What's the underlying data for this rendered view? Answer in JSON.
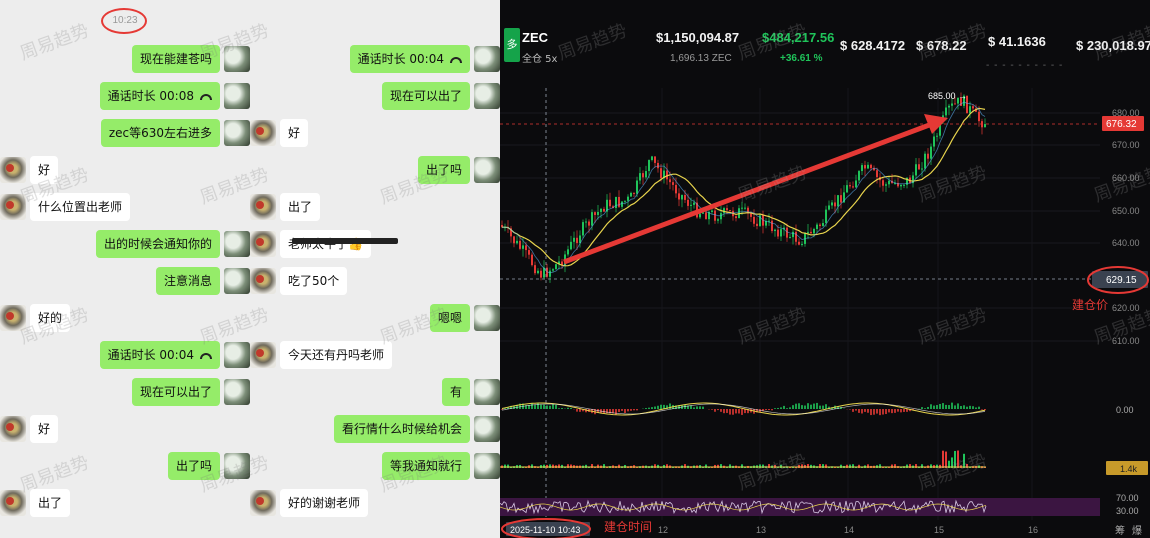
{
  "chat": {
    "timestamp": "10:23",
    "left_column": [
      {
        "side": "me",
        "text": "现在能建苍吗"
      },
      {
        "side": "me",
        "text": "通话时长 00:08",
        "call": true
      },
      {
        "side": "me",
        "text": "zec等630左右进多"
      },
      {
        "side": "them",
        "text": "好"
      },
      {
        "side": "them",
        "text": "什么位置出老师"
      },
      {
        "side": "me",
        "text": "出的时候会通知你的"
      },
      {
        "side": "me",
        "text": "注意消息"
      },
      {
        "side": "them",
        "text": "好的"
      },
      {
        "side": "me",
        "text": "通话时长 00:04",
        "call": true
      },
      {
        "side": "me",
        "text": "现在可以出了"
      },
      {
        "side": "them",
        "text": "好"
      },
      {
        "side": "me",
        "text": "出了吗"
      },
      {
        "side": "them",
        "text": "出了"
      }
    ],
    "right_column": [
      {
        "side": "me",
        "text": "通话时长 00:04",
        "call": true
      },
      {
        "side": "me",
        "text": "现在可以出了"
      },
      {
        "side": "them",
        "text": "好"
      },
      {
        "side": "me",
        "text": "出了吗"
      },
      {
        "side": "them",
        "text": "出了"
      },
      {
        "side": "them",
        "text": "老师太牛了👍"
      },
      {
        "side": "them",
        "text": "吃了50个"
      },
      {
        "side": "me",
        "text": "嗯嗯"
      },
      {
        "side": "them",
        "text": "今天还有丹吗老师"
      },
      {
        "side": "me",
        "text": "有"
      },
      {
        "side": "me",
        "text": "看行情什么时候给机会"
      },
      {
        "side": "me",
        "text": "等我通知就行"
      },
      {
        "side": "them",
        "text": "好的谢谢老师"
      }
    ],
    "watermark": "周易趋势"
  },
  "trade": {
    "side_badge": "多",
    "symbol": "ZEC",
    "margin_mode": "全仓 5x",
    "position_value": "$1,150,094.87",
    "position_size": "1,696.13 ZEC",
    "pnl": "$484,217.56",
    "pnl_pct": "+36.61 %",
    "entry_price": "$ 628.4172",
    "mark_price": "$ 678.22",
    "liq_price": "$ 41.1636",
    "margin": "$ 230,018.97",
    "placeholder_dots": "- - - - - - - - - -",
    "price_peak_label": "685.00",
    "current_price_tag": "676.32",
    "entry_price_tag": "629.15",
    "entry_price_caption": "建仓价",
    "entry_time_tag": "2025-11-10 10:43",
    "entry_time_caption": "建仓时间",
    "right_corner_1": "筹",
    "right_corner_2": "爆",
    "price_axis": [
      "680.00",
      "670.00",
      "660.00",
      "650.00",
      "640.00",
      "620.00",
      "610.00"
    ],
    "macd_axis": "0.00",
    "vol_axis": "1.4k",
    "rsi_axis_top": "70.00",
    "rsi_axis_bottom": "30.00",
    "time_axis": [
      "12",
      "13",
      "14",
      "15",
      "16"
    ],
    "watermark": "周易趋势",
    "colors": {
      "up": "#1fc45a",
      "down": "#e53935",
      "ma": "#e8d44d",
      "bg": "#0b0b0d"
    }
  }
}
